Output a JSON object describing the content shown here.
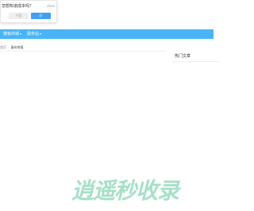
{
  "popup": {
    "title": "您想知道成本吗？",
    "close_label": "close",
    "cancel_label": "不要",
    "ok_label": "好"
  },
  "nav": {
    "items": [
      {
        "label": "模板商城"
      },
      {
        "label": "服务站"
      }
    ],
    "background": "#48b4f7"
  },
  "breadcrumb": {
    "home": "首页",
    "current": "备份修复"
  },
  "sidebar": {
    "title": "热门文章"
  },
  "watermark": {
    "text": "逍遥秒收录",
    "color": "#a6e0c8"
  },
  "colors": {
    "accent": "#3f9ff2"
  }
}
